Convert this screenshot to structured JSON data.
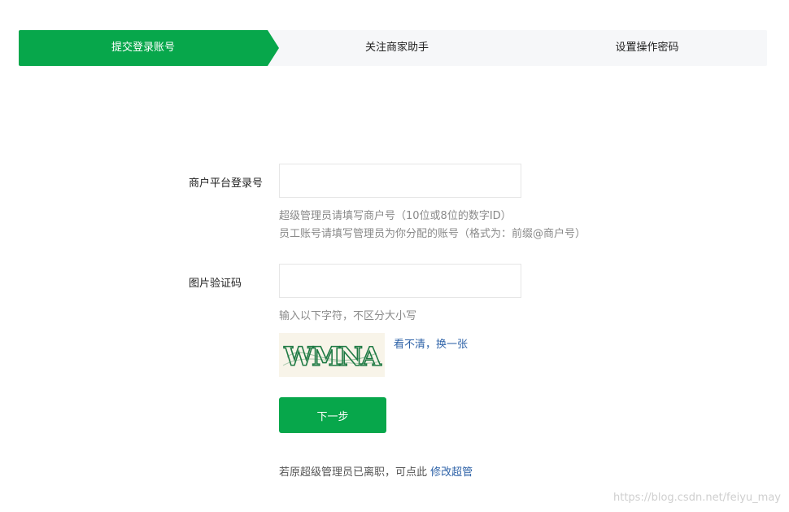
{
  "steps": [
    {
      "label": "提交登录账号"
    },
    {
      "label": "关注商家助手"
    },
    {
      "label": "设置操作密码"
    }
  ],
  "form": {
    "account_label": "商户平台登录号",
    "account_value": "",
    "account_hint_1": "超级管理员请填写商户号（10位或8位的数字ID）",
    "account_hint_2": "员工账号请填写管理员为你分配的账号（格式为：前缀@商户号）",
    "captcha_label": "图片验证码",
    "captcha_value": "",
    "captcha_hint": "输入以下字符，不区分大小写",
    "captcha_text": "WMNA",
    "refresh_link": "看不清，换一张",
    "next_button": "下一步",
    "footer_text": "若原超级管理员已离职，可点此",
    "footer_link": "修改超管"
  },
  "watermark": "https://blog.csdn.net/feiyu_may",
  "colors": {
    "primary": "#07a74b",
    "link": "#2f63a8",
    "hint": "#8a8a8a"
  }
}
